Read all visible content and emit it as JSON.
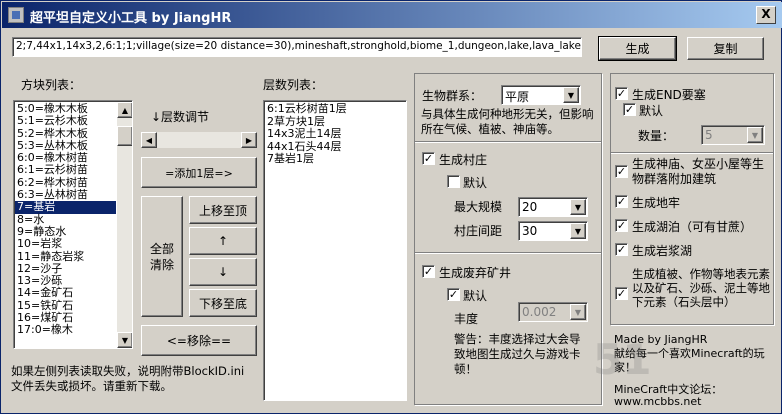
{
  "window": {
    "title": "超平坦自定义小工具 by JiangHR",
    "close_glyph": "X"
  },
  "top": {
    "preset_value": "2;7,44x1,14x3,2,6:1;1;village(size=20 distance=30),mineshaft,stronghold,biome_1,dungeon,lake,lava_lake,decoration",
    "generate_label": "生成",
    "copy_label": "复制"
  },
  "blocks": {
    "label": "方块列表：",
    "items": [
      "5:0=橡木木板",
      "5:1=云杉木板",
      "5:2=桦木木板",
      "5:3=丛林木板",
      "6:0=橡木树苗",
      "6:1=云杉树苗",
      "6:2=桦木树苗",
      "6:3=丛林树苗",
      "7=基岩",
      "8=水",
      "9=静态水",
      "10=岩浆",
      "11=静态岩浆",
      "12=沙子",
      "13=沙砾",
      "14=金矿石",
      "15=铁矿石",
      "16=煤矿石",
      "17:0=橡木"
    ],
    "selected_index": 8
  },
  "layers_adjust_label": "↓层数调节",
  "buttons": {
    "add_layer": "=添加1层=>",
    "clear_all": "全部\n清除",
    "move_top": "上移至顶",
    "up": "↑",
    "down": "↓",
    "move_bottom": "下移至底",
    "remove": "<=移除=="
  },
  "layers": {
    "label": "层数列表：",
    "items": [
      "6:1云杉树苗1层",
      "2草方块1层",
      "14x3泥土14层",
      "44x1石头44层",
      "7基岩1层"
    ]
  },
  "warning": "如果左侧列表读取失败，说明附带BlockID.ini文件丢失或损坏。请重新下载。",
  "biome": {
    "label": "生物群系：",
    "value": "平原",
    "note": "与具体生成何种地形无关，但影响所在气候、植被、神庙等。"
  },
  "village": {
    "label": "生成村庄",
    "default_label": "默认",
    "size_label": "最大规模",
    "size_value": "20",
    "distance_label": "村庄间距",
    "distance_value": "30",
    "checked": true,
    "default_checked": false
  },
  "mineshaft": {
    "label": "生成废弃矿井",
    "default_label": "默认",
    "density_label": "丰度",
    "density_value": "0.002",
    "warning": "警告：丰度选择过大会导致地图生成过久与游戏卡顿！",
    "checked": true,
    "default_checked": true
  },
  "stronghold": {
    "label": "生成END要塞",
    "default_label": "默认",
    "count_label": "数量：",
    "count_value": "5",
    "checked": true,
    "default_checked": true
  },
  "options": [
    {
      "label": "生成神庙、女巫小屋等生物群落附加建筑",
      "checked": true
    },
    {
      "label": "生成地牢",
      "checked": true
    },
    {
      "label": "生成湖泊（可有甘蔗）",
      "checked": true
    },
    {
      "label": "生成岩浆湖",
      "checked": true
    },
    {
      "label": "生成植被、作物等地表元素以及矿石、沙砾、泥土等地下元素（石头层中）",
      "checked": true
    }
  ],
  "credits": {
    "made_by": "Made by JiangHR",
    "dedication": "献给每一个喜欢Minecraft的玩家！",
    "forum_label": "MineCraft中文论坛：",
    "forum_url": "www.mcbbs.net"
  },
  "watermark": "51"
}
